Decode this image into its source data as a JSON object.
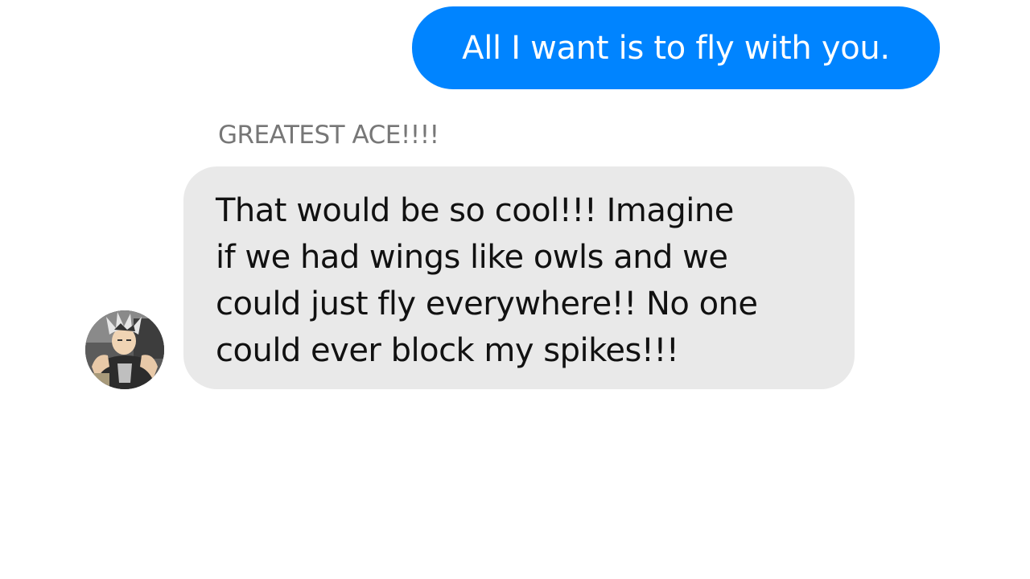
{
  "messages": {
    "outgoing": {
      "text": "All I want is to fly with you.",
      "color": "#0084ff"
    },
    "incoming": {
      "sender": "GREATEST ACE!!!!",
      "lines": [
        "That would be so cool!!! Imagine",
        "if we had wings like owls and we",
        "could just fly everywhere!! No one",
        "could ever block my spikes!!!"
      ],
      "color": "#e9e9e9"
    }
  },
  "avatar": {
    "icon": "user-avatar-icon"
  }
}
